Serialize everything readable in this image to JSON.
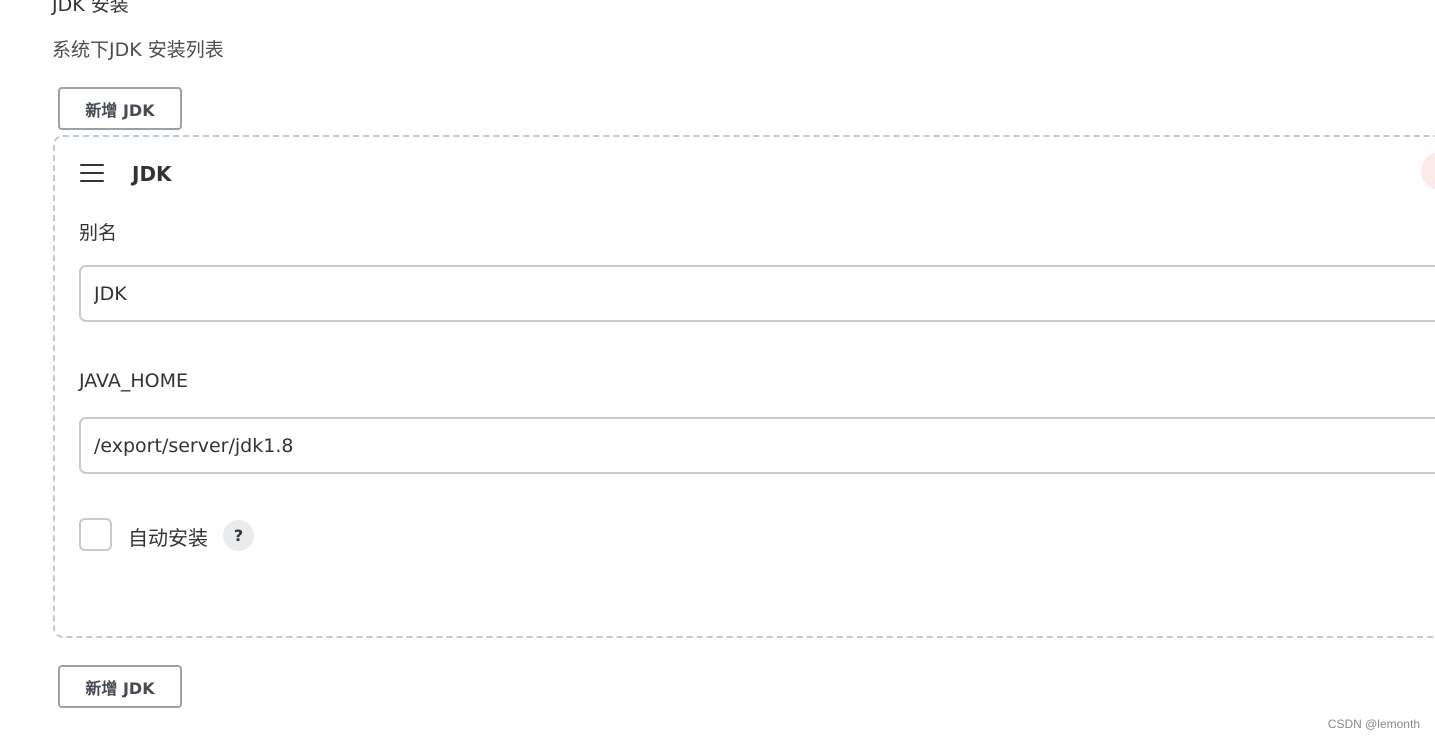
{
  "section": {
    "title": "JDK 安装",
    "description": "系统下JDK 安装列表"
  },
  "add_button_label": "新增 JDK",
  "jdk_item": {
    "title": "JDK",
    "alias_label": "别名",
    "alias_value": "JDK",
    "java_home_label": "JAVA_HOME",
    "java_home_value": "/export/server/jdk1.8",
    "auto_install_label": "自动安装",
    "auto_install_checked": false,
    "help_symbol": "?"
  },
  "icons": {
    "drag": "drag-handle-icon",
    "help": "help-icon",
    "delete": "delete-icon"
  },
  "colors": {
    "border": "#c3cad0",
    "button_border": "#9aa2a9",
    "delete_bg": "#fdeaea"
  },
  "watermark": "CSDN @lemonth"
}
